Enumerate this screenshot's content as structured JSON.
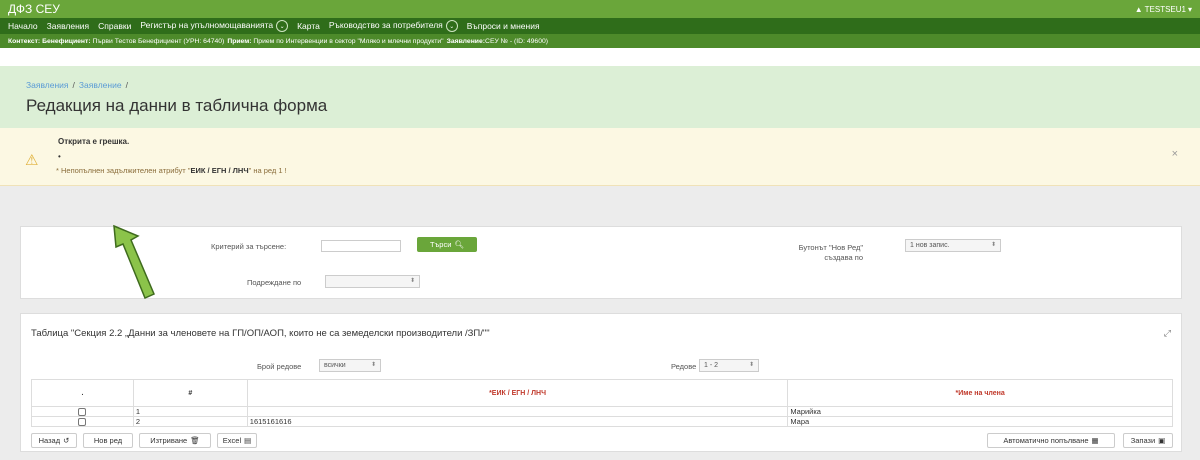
{
  "app": {
    "title": "ДФЗ СЕУ",
    "user": "TESTSEU1"
  },
  "nav": [
    {
      "label": "Начало"
    },
    {
      "label": "Заявления"
    },
    {
      "label": "Справки"
    },
    {
      "label": "Регистър на упълномощаванията"
    },
    {
      "label": "Карта"
    },
    {
      "label": "Ръководство за потребителя"
    },
    {
      "label": "Въпроси и мнения"
    }
  ],
  "context": {
    "k1": "Контекст:",
    "k2": "Бенефициент:",
    "v2": "Първи Тестов Бенефициент (УРН: 64740)",
    "k3": "Прием:",
    "v3": "Прием по Интервенции в сектор \"Мляко и млечни продукти\"",
    "k4": "Заявление:",
    "v4": "СЕУ № - (ID: 49600)"
  },
  "breadcrumb": {
    "item1": "Заявления",
    "item2": "Заявление",
    "sep": "/"
  },
  "page_title": "Редакция на данни в таблична форма",
  "alert": {
    "title": "Открита е грешка.",
    "bullet": "•",
    "msg_prefix": "* Непопълнен задължителен атрибут \"",
    "msg_attr": "ЕИК / ЕГН / ЛНЧ",
    "msg_suffix": "\" на ред 1 !",
    "close": "×"
  },
  "search": {
    "criteria_label": "Критерий за търсене:",
    "search_button": "Търси",
    "sort_label": "Подреждане по",
    "new_row_label_1": "Бутонът \"Нов Ред\"",
    "new_row_label_2": "създава по",
    "new_row_value": "1 нов запис."
  },
  "table_panel": {
    "title": "Таблица \"Секция 2.2 „Данни за членовете на ГП/ОП/АОП, които не са земеделски производители /ЗП/\"\"",
    "rows_count_label": "Брой редове",
    "rows_count_value": "всички",
    "rows_label": "Редове",
    "rows_value": "1 - 2",
    "columns": [
      ".",
      "#",
      "*ЕИК / ЕГН / ЛНЧ",
      "*Име на члена"
    ],
    "rows": [
      {
        "num": "1",
        "eik": "",
        "name": "Марийка"
      },
      {
        "num": "2",
        "eik": "1615161616",
        "name": "Мара"
      }
    ]
  },
  "buttons": {
    "back": "Назад",
    "new_row": "Нов ред",
    "delete": "Изтриване",
    "excel": "Excel",
    "autofill": "Автоматично попълване",
    "save": "Запази"
  },
  "colors": {
    "topbar": "#6aa63a",
    "navbar": "#2f6d1a",
    "context": "#4d8a2a",
    "arrow": "#8bc34a",
    "required": "#c0392b"
  }
}
